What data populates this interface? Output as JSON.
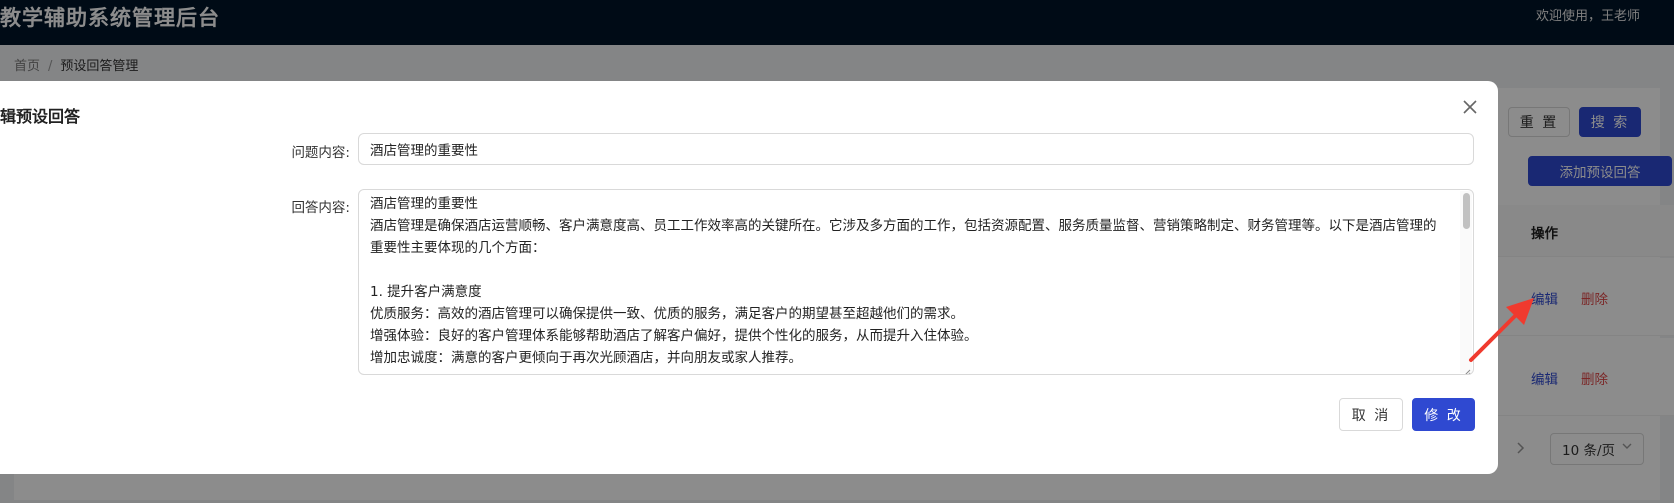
{
  "header": {
    "app_title": "教学辅助系统管理后台",
    "welcome": "欢迎使用，王老师"
  },
  "breadcrumb": {
    "home": "首页",
    "separator": "/",
    "current": "预设回答管理"
  },
  "toolbar": {
    "reset_label": "重 置",
    "search_label": "搜 索",
    "add_label": "添加预设回答"
  },
  "table": {
    "action_header": "操作",
    "rows": [
      {
        "edit_label": "编辑",
        "delete_label": "删除"
      },
      {
        "edit_label": "编辑",
        "delete_label": "删除"
      }
    ]
  },
  "pagination": {
    "next_icon": "chevron-right-icon",
    "page_size": "10 条/页"
  },
  "modal": {
    "title": "辑预设回答",
    "close_icon": "close-icon",
    "question_label": "问题内容:",
    "question_value": "酒店管理的重要性",
    "answer_label": "回答内容:",
    "answer_lines": [
      "酒店管理的重要性",
      "酒店管理是确保酒店运营顺畅、客户满意度高、员工工作效率高的关键所在。它涉及多方面的工作，包括资源配置、服务质量监督、营销策略制定、财务管理等。以下是酒店管理的",
      "重要性主要体现的几个方面：",
      "",
      "1. 提升客户满意度",
      "优质服务：高效的酒店管理可以确保提供一致、优质的服务，满足客户的期望甚至超越他们的需求。",
      "增强体验：良好的客户管理体系能够帮助酒店了解客户偏好，提供个性化的服务，从而提升入住体验。",
      "增加忠诚度：满意的客户更倾向于再次光顾酒店，并向朋友或家人推荐。"
    ],
    "cancel_label": "取 消",
    "ok_label": "修 改"
  },
  "colors": {
    "primary": "#2f49d1",
    "danger": "#e04848",
    "header_bg": "#001529",
    "annotation_arrow": "#f03a2e"
  }
}
